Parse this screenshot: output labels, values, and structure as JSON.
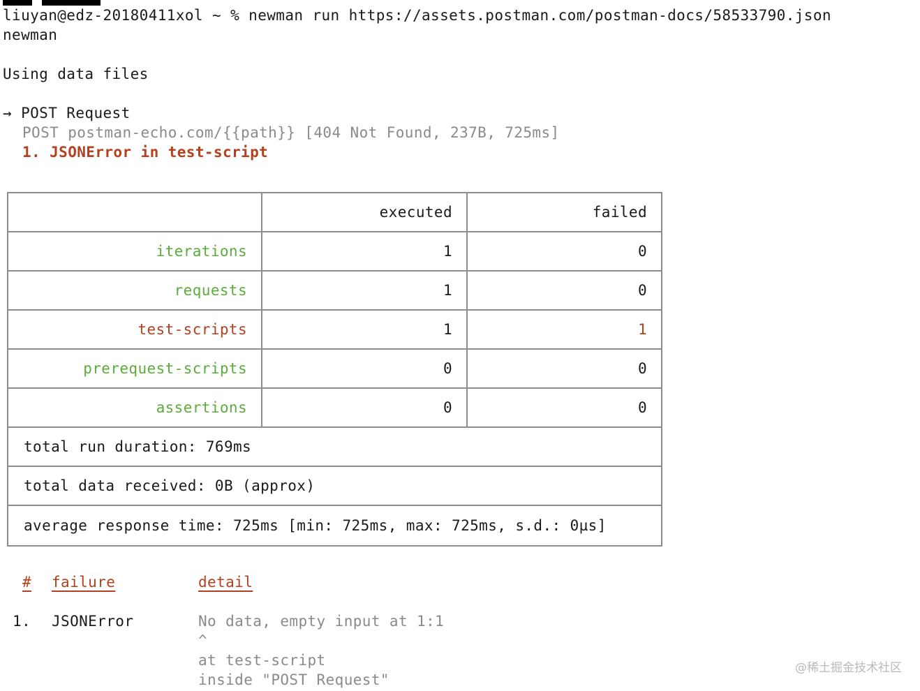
{
  "terminal": {
    "prompt": "liuyan@edz-20180411xol ~ % newman run https://assets.postman.com/postman-docs/58533790.json",
    "app_name": "newman",
    "data_files": "Using data files",
    "request_arrow": "→",
    "request_name": "POST Request",
    "request_line": "POST postman-echo.com/{{path}} [404 Not Found, 237B, 725ms]",
    "error_line": "1. JSONError in test-script"
  },
  "summary_table": {
    "headers": [
      "",
      "executed",
      "failed"
    ],
    "rows": [
      {
        "label": "iterations",
        "executed": "1",
        "failed": "0",
        "status": "ok"
      },
      {
        "label": "requests",
        "executed": "1",
        "failed": "0",
        "status": "ok"
      },
      {
        "label": "test-scripts",
        "executed": "1",
        "failed": "1",
        "status": "fail"
      },
      {
        "label": "prerequest-scripts",
        "executed": "0",
        "failed": "0",
        "status": "ok"
      },
      {
        "label": "assertions",
        "executed": "0",
        "failed": "0",
        "status": "ok"
      }
    ],
    "total_run_duration": "total run duration: 769ms",
    "total_data_received": "total data received: 0B (approx)",
    "average_response_time": "average response time: 725ms [min: 725ms, max: 725ms, s.d.: 0µs]"
  },
  "failures": {
    "headers": {
      "index": "#",
      "failure": "failure",
      "detail": "detail"
    },
    "items": [
      {
        "index": "1.",
        "failure": "JSONError",
        "detail_lines": [
          "No data, empty input at 1:1",
          "^",
          "at test-script",
          "inside \"POST Request\""
        ]
      }
    ]
  },
  "colors": {
    "ok": "#5aad3a",
    "fail": "#b3401f",
    "gray": "#8a8a8a",
    "border": "#8d8d8d"
  },
  "watermark": "@稀土掘金技术社区"
}
